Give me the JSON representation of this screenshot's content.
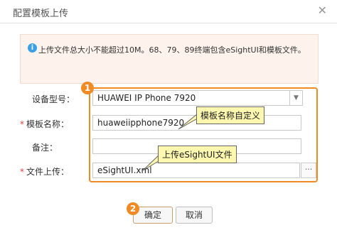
{
  "dialog": {
    "title": "配置模板上传",
    "close_icon": "close-icon"
  },
  "notice": {
    "icon": "info-icon",
    "icon_glyph": "i",
    "text": "上传文件总大小不能超过10M。68、79、89终端包含eSightUI和模板文件。"
  },
  "form": {
    "model": {
      "label": "设备型号：",
      "value": "HUAWEI IP Phone 7920",
      "required": false
    },
    "template_name": {
      "label": "模板名称：",
      "value": "huaweiipphone7920",
      "required": true,
      "required_mark": "*"
    },
    "remark": {
      "label": "备注：",
      "value": "",
      "required": false
    },
    "file": {
      "label": "文件上传：",
      "value": "eSightUI.xml",
      "required": true,
      "required_mark": "*",
      "browse_label": "···"
    }
  },
  "annotations": {
    "step1": "1",
    "step2": "2",
    "callout_name": "模板名称自定义",
    "callout_file": "上传eSightUI文件"
  },
  "buttons": {
    "ok": "确定",
    "cancel": "取消"
  },
  "colors": {
    "accent": "#f08a24",
    "callout_bg": "#fdf7b0",
    "notice_bg": "#fdf3ec",
    "info": "#3aa0e6"
  }
}
